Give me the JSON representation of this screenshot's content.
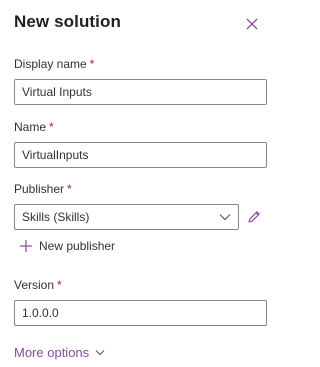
{
  "panel": {
    "title": "New solution",
    "close_icon": "close-icon"
  },
  "fields": {
    "display_name": {
      "label": "Display name",
      "required_mark": "*",
      "value": "Virtual Inputs"
    },
    "name": {
      "label": "Name",
      "required_mark": "*",
      "value": "VirtualInputs"
    },
    "publisher": {
      "label": "Publisher",
      "required_mark": "*",
      "selected": "Skills (Skills)",
      "dropdown_icon": "chevron-down-icon",
      "edit_icon": "pencil-icon"
    },
    "version": {
      "label": "Version",
      "required_mark": "*",
      "value": "1.0.0.0"
    }
  },
  "actions": {
    "new_publisher_label": "New publisher",
    "new_publisher_icon": "plus-icon",
    "more_options_label": "More options",
    "more_options_icon": "chevron-down-icon"
  },
  "colors": {
    "accent": "#8a4a9c",
    "required": "#a4262c",
    "border": "#8a8886",
    "text": "#323130"
  }
}
